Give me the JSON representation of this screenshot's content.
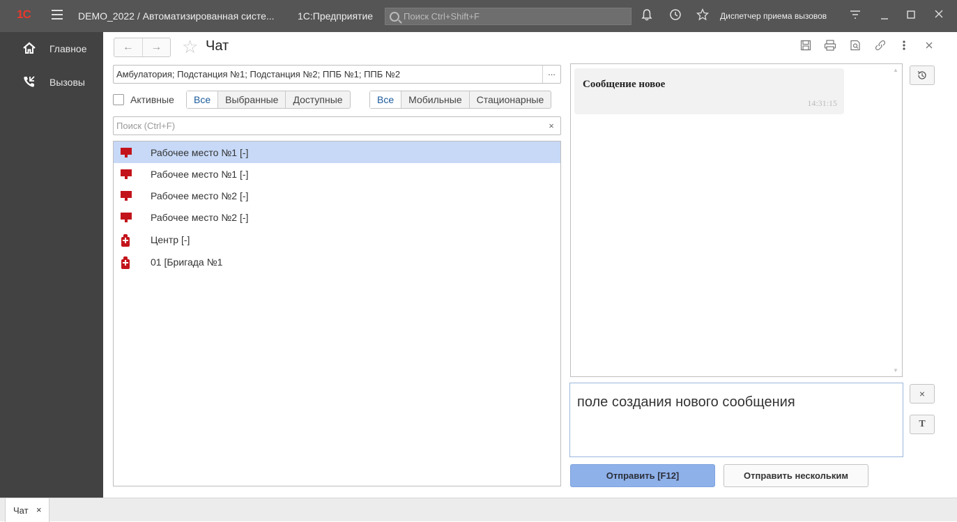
{
  "titlebar": {
    "logo": "1С",
    "title": "DEMO_2022 / Автоматизированная систе...",
    "product": "1С:Предприятие",
    "search_placeholder": "Поиск Ctrl+Shift+F",
    "user": "Диспетчер приема вызовов"
  },
  "sidebar": {
    "items": [
      {
        "label": "Главное",
        "icon": "home-icon"
      },
      {
        "label": "Вызовы",
        "icon": "phone-icon"
      }
    ]
  },
  "page": {
    "title": "Чат"
  },
  "filters": {
    "selection": "Амбулатория; Подстанция №1; Подстанция №2; ППБ №1; ППБ №2",
    "select_button": "...",
    "active_label": "Активные",
    "group1": [
      "Все",
      "Выбранные",
      "Доступные"
    ],
    "group2": [
      "Все",
      "Мобильные",
      "Стационарные"
    ],
    "search_placeholder": "Поиск (Ctrl+F)"
  },
  "list": {
    "rows": [
      {
        "label": "Рабочее место №1 [-]",
        "icon": "workstation-icon",
        "selected": true
      },
      {
        "label": "Рабочее место №1 [-]",
        "icon": "workstation-icon",
        "selected": false
      },
      {
        "label": "Рабочее место №2 [-]",
        "icon": "workstation-icon",
        "selected": false
      },
      {
        "label": "Рабочее место №2 [-]",
        "icon": "workstation-icon",
        "selected": false
      },
      {
        "label": "Центр [-]",
        "icon": "ambulance-icon",
        "selected": false
      },
      {
        "label": "01 [Бригада №1",
        "icon": "ambulance-icon",
        "selected": false
      }
    ]
  },
  "chat": {
    "messages": [
      {
        "text": "Сообщение новое",
        "time": "14:31:15"
      }
    ],
    "compose_text": "поле создания нового сообщения"
  },
  "buttons": {
    "send": "Отправить [F12]",
    "send_many": "Отправить нескольким",
    "clear": "×",
    "format": "Т"
  },
  "tabs": [
    {
      "label": "Чат",
      "close": "×"
    }
  ],
  "colors": {
    "titlebar": "#555555",
    "sidebar": "#424242",
    "accent": "#8fb1ea",
    "selected_row": "#c7d9f7",
    "icon_red": "#c3141b"
  }
}
